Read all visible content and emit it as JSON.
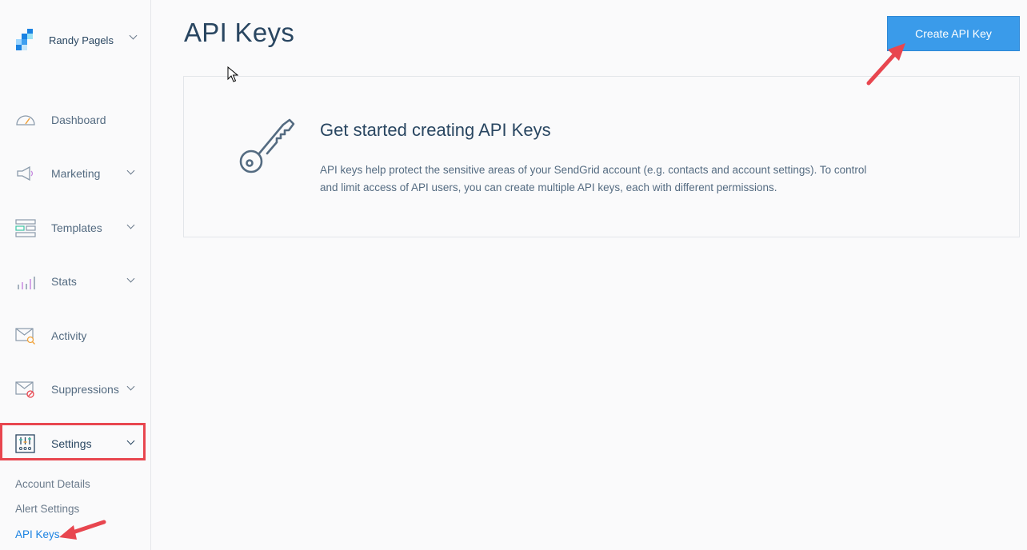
{
  "account": {
    "name": "Randy Pagels"
  },
  "nav": {
    "items": [
      {
        "label": "Dashboard",
        "has_chevron": false
      },
      {
        "label": "Marketing",
        "has_chevron": true
      },
      {
        "label": "Templates",
        "has_chevron": true
      },
      {
        "label": "Stats",
        "has_chevron": true
      },
      {
        "label": "Activity",
        "has_chevron": false
      },
      {
        "label": "Suppressions",
        "has_chevron": true
      },
      {
        "label": "Settings",
        "has_chevron": true,
        "expanded": true
      }
    ],
    "settings_subitems": [
      {
        "label": "Account Details"
      },
      {
        "label": "Alert Settings"
      },
      {
        "label": "API Keys",
        "active": true
      }
    ]
  },
  "main": {
    "title": "API Keys",
    "create_button": "Create API Key",
    "empty_state": {
      "heading": "Get started creating API Keys",
      "description": "API keys help protect the sensitive areas of your SendGrid account (e.g. contacts and account settings). To control and limit access of API users, you can create multiple API keys, each with different permissions."
    }
  },
  "colors": {
    "accent": "#1a82e2",
    "button": "#3a9bea",
    "annotation": "#e8464f",
    "text": "#294661"
  }
}
